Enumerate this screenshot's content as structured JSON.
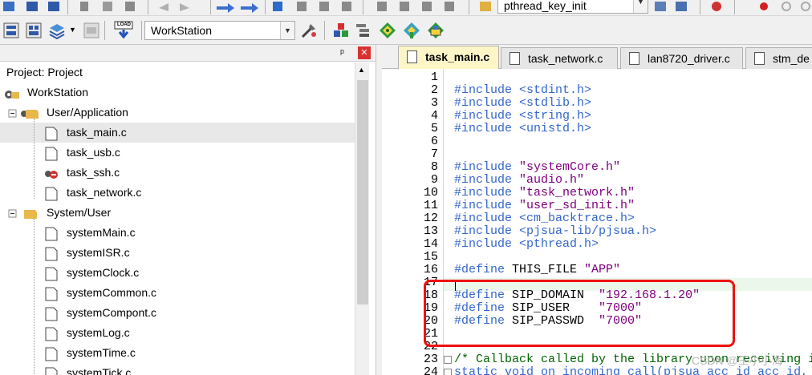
{
  "toolbar_top": {
    "function_combo": "pthread_key_init"
  },
  "toolbar_main": {
    "target_combo": "WorkStation",
    "load_label": "LOAD"
  },
  "project": {
    "title": "Project: Project",
    "items": [
      {
        "label": "WorkStation"
      },
      {
        "label": "User/Application"
      },
      {
        "label": "task_main.c"
      },
      {
        "label": "task_usb.c"
      },
      {
        "label": "task_ssh.c"
      },
      {
        "label": "task_network.c"
      },
      {
        "label": "System/User"
      },
      {
        "label": "systemMain.c"
      },
      {
        "label": "systemISR.c"
      },
      {
        "label": "systemClock.c"
      },
      {
        "label": "systemCommon.c"
      },
      {
        "label": "systemCompont.c"
      },
      {
        "label": "systemLog.c"
      },
      {
        "label": "systemTime.c"
      },
      {
        "label": "systemTick.c"
      }
    ]
  },
  "tabs": [
    {
      "label": "task_main.c"
    },
    {
      "label": "task_network.c"
    },
    {
      "label": "lan8720_driver.c"
    },
    {
      "label": "stm_de"
    }
  ],
  "editor": {
    "lines": [
      {
        "n": "1",
        "code": ""
      },
      {
        "n": "2",
        "code": "#include <stdint.h>"
      },
      {
        "n": "3",
        "code": "#include <stdlib.h>"
      },
      {
        "n": "4",
        "code": "#include <string.h>"
      },
      {
        "n": "5",
        "code": "#include <unistd.h>"
      },
      {
        "n": "6",
        "code": ""
      },
      {
        "n": "7",
        "code": ""
      },
      {
        "n": "8",
        "code": "#include \"systemCore.h\""
      },
      {
        "n": "9",
        "code": "#include \"audio.h\""
      },
      {
        "n": "10",
        "code": "#include \"task_network.h\""
      },
      {
        "n": "11",
        "code": "#include \"user_sd_init.h\""
      },
      {
        "n": "12",
        "code": "#include <cm_backtrace.h>"
      },
      {
        "n": "13",
        "code": "#include <pjsua-lib/pjsua.h>"
      },
      {
        "n": "14",
        "code": "#include <pthread.h>"
      },
      {
        "n": "15",
        "code": ""
      },
      {
        "n": "16",
        "code": "#define THIS_FILE \"APP\""
      },
      {
        "n": "17",
        "code": ""
      },
      {
        "n": "18",
        "code": "#define SIP_DOMAIN  \"192.168.1.20\""
      },
      {
        "n": "19",
        "code": "#define SIP_USER    \"7000\""
      },
      {
        "n": "20",
        "code": "#define SIP_PASSWD  \"7000\""
      },
      {
        "n": "21",
        "code": ""
      },
      {
        "n": "22",
        "code": ""
      },
      {
        "n": "23",
        "code": "/* Callback called by the library upon receiving in"
      },
      {
        "n": "24",
        "code": "static void on_incoming_call(pjsua_acc_id acc_id, pjsi"
      }
    ]
  },
  "watermark": "CSDN @王小小海",
  "colors": {
    "accent_box": "#ee1111",
    "keyword": "#3366cc",
    "string": "#800080",
    "comment": "#006400",
    "active_tab": "#fff6c8"
  }
}
